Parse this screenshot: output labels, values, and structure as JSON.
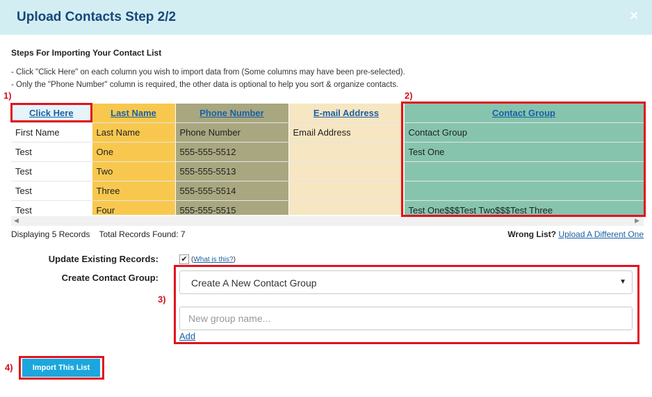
{
  "header": {
    "title": "Upload Contacts Step 2/2",
    "close": "×"
  },
  "steps": {
    "title": "Steps For Importing Your Contact List",
    "lines": [
      "- Click \"Click Here\" on each column you wish to import data from (Some columns may have been pre-selected).",
      "- Only the \"Phone Number\" column is required, the other data is optional to help you sort & organize contacts."
    ]
  },
  "table": {
    "headers": [
      "Click Here",
      "Last Name",
      "Phone Number",
      "E-mail Address",
      "Contact Group"
    ],
    "rows": [
      [
        "First Name",
        "Last Name",
        "Phone Number",
        "Email Address",
        "Contact Group"
      ],
      [
        "Test",
        "One",
        "555-555-5512",
        "",
        "Test One"
      ],
      [
        "Test",
        "Two",
        "555-555-5513",
        "",
        ""
      ],
      [
        "Test",
        "Three",
        "555-555-5514",
        "",
        ""
      ],
      [
        "Test",
        "Four",
        "555-555-5515",
        "",
        "Test One$$$Test Two$$$Test Three"
      ]
    ]
  },
  "scroll": {
    "left": "◀",
    "right": "▶"
  },
  "records": {
    "text": "Displaying 5 Records    Total Records Found: 7"
  },
  "wrong": {
    "label": "Wrong List?",
    "link": "Upload A Different One"
  },
  "form": {
    "update_label": "Update Existing Records:",
    "update_checked": "✔",
    "what_is": "What is this?",
    "group_label": "Create Contact Group:",
    "group_select": "Create A New Contact Group",
    "group_placeholder": "New group name...",
    "add": "Add"
  },
  "import_button": "Import This List",
  "markers": [
    "1)",
    "2)",
    "3)",
    "4)"
  ],
  "colors": {
    "annotation": "#e1121d",
    "button": "#1ba7de",
    "header_bg": "#d2eef3"
  }
}
